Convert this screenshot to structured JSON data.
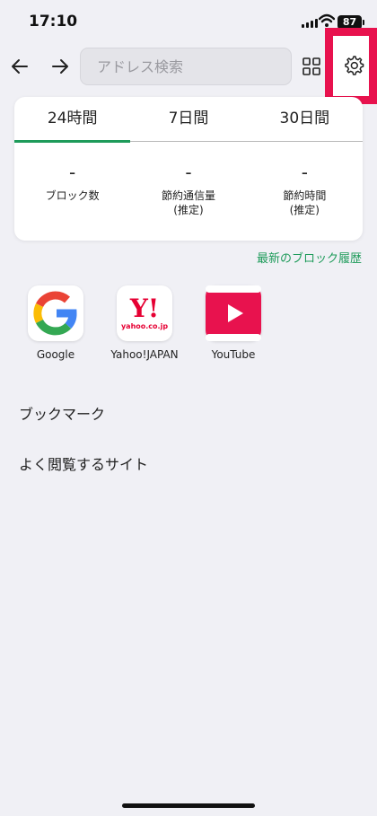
{
  "status_bar": {
    "time": "17:10",
    "battery": "87"
  },
  "toolbar": {
    "address_placeholder": "アドレス検索"
  },
  "stats": {
    "tabs": [
      {
        "label": "24時間",
        "selected": true
      },
      {
        "label": "7日間",
        "selected": false
      },
      {
        "label": "30日間",
        "selected": false
      }
    ],
    "items": [
      {
        "value": "-",
        "label": "ブロック数",
        "sublabel": ""
      },
      {
        "value": "-",
        "label": "節約通信量",
        "sublabel": "(推定)"
      },
      {
        "value": "-",
        "label": "節約時間",
        "sublabel": "(推定)"
      }
    ],
    "history_link": "最新のブロック履歴"
  },
  "shortcuts": [
    {
      "label": "Google",
      "icon": "google-icon"
    },
    {
      "label": "Yahoo!JAPAN",
      "icon": "yahoo-japan-icon",
      "icon_text": "Y!",
      "icon_subtext": "yahoo.co.jp"
    },
    {
      "label": "YouTube",
      "icon": "youtube-icon"
    }
  ],
  "sections": {
    "bookmarks": "ブックマーク",
    "frequent": "よく閲覧するサイト"
  },
  "colors": {
    "accent": "#1e9b5a",
    "highlight": "#e8124e",
    "background": "#f0f0f5"
  }
}
